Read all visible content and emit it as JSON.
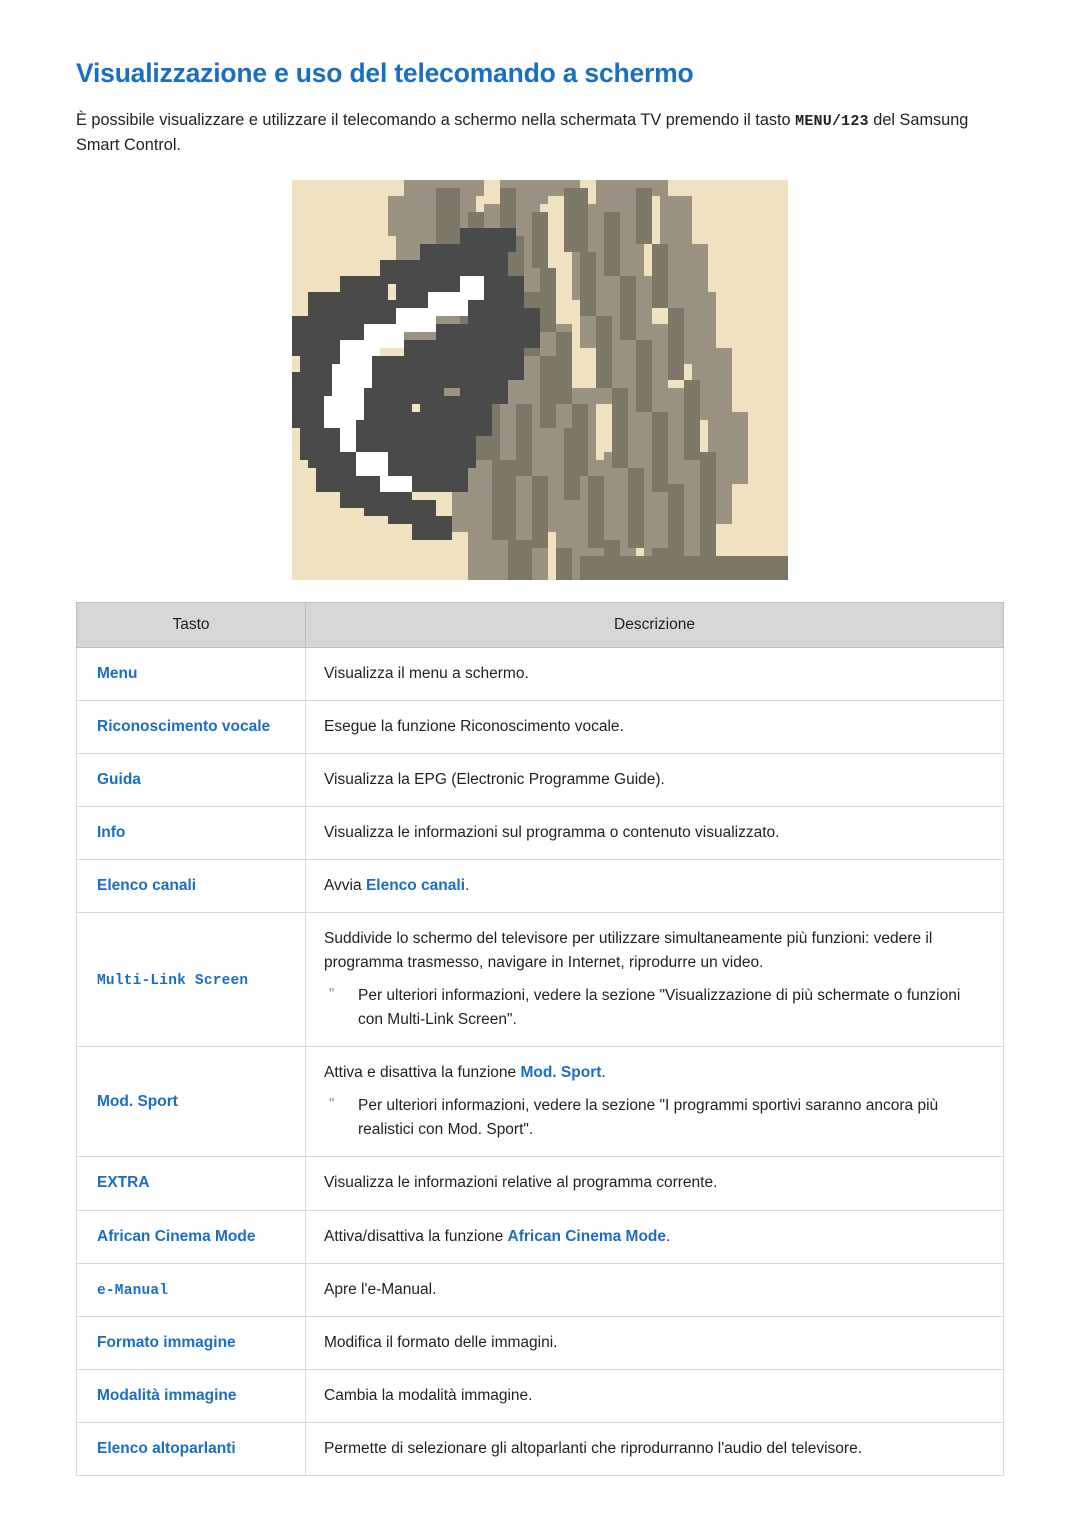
{
  "page": {
    "title": "Visualizzazione e uso del telecomando a schermo",
    "intro_before": "È possibile visualizzare e utilizzare il telecomando a schermo nella schermata TV premendo il tasto ",
    "intro_code": "MENU/123",
    "intro_after": " del Samsung Smart Control."
  },
  "illustration": {
    "name": "hand-holding-remote-illustration",
    "bg_color": "#f0e2c0",
    "remote_color": "#4a4a4a",
    "hand_color": "#9a9382",
    "shade_color": "#7d7767"
  },
  "table": {
    "headers": [
      "Tasto",
      "Descrizione"
    ],
    "rows": [
      {
        "key": "Menu",
        "key_style": "bold-blue",
        "desc": "Visualizza il menu a schermo."
      },
      {
        "key": "Riconoscimento vocale",
        "key_style": "bold-blue",
        "desc": "Esegue la funzione Riconoscimento vocale."
      },
      {
        "key": "Guida",
        "key_style": "bold-blue",
        "desc": "Visualizza la EPG (Electronic Programme Guide)."
      },
      {
        "key": "Info",
        "key_style": "bold-blue",
        "desc": "Visualizza le informazioni sul programma o contenuto visualizzato."
      },
      {
        "key": "Elenco canali",
        "key_style": "bold-blue",
        "desc_prefix": "Avvia ",
        "desc_highlight": "Elenco canali",
        "desc_suffix": "."
      },
      {
        "key": "Multi-Link Screen",
        "key_style": "bold-blue-mono",
        "desc": "Suddivide lo schermo del televisore per utilizzare simultaneamente più funzioni: vedere il programma trasmesso, navigare in Internet, riprodurre un video.",
        "note": "Per ulteriori informazioni, vedere la sezione \"Visualizzazione di più schermate o funzioni con Multi-Link Screen\"."
      },
      {
        "key": "Mod. Sport",
        "key_style": "bold-blue",
        "desc_prefix": "Attiva e disattiva la funzione ",
        "desc_highlight": "Mod. Sport",
        "desc_suffix": ".",
        "note": "Per ulteriori informazioni, vedere la sezione \"I programmi sportivi saranno ancora più realistici con Mod. Sport\"."
      },
      {
        "key": "EXTRA",
        "key_style": "bold-blue",
        "desc": "Visualizza le informazioni relative al programma corrente."
      },
      {
        "key": "African Cinema Mode",
        "key_style": "bold-blue",
        "desc_prefix": "Attiva/disattiva la funzione ",
        "desc_highlight": "African Cinema Mode",
        "desc_suffix": "."
      },
      {
        "key": "e-Manual",
        "key_style": "bold-blue-mono",
        "desc": "Apre l'e-Manual."
      },
      {
        "key": "Formato immagine",
        "key_style": "bold-blue",
        "desc": "Modifica il formato delle immagini."
      },
      {
        "key": "Modalità immagine",
        "key_style": "bold-blue",
        "desc": "Cambia la modalità immagine."
      },
      {
        "key": "Elenco altoparlanti",
        "key_style": "bold-blue",
        "desc": "Permette di selezionare gli altoparlanti che riprodurranno l'audio del televisore."
      }
    ]
  },
  "colors": {
    "accent": "#1a6fc4",
    "header_bg": "#d7d7d7",
    "text": "#231f20"
  }
}
